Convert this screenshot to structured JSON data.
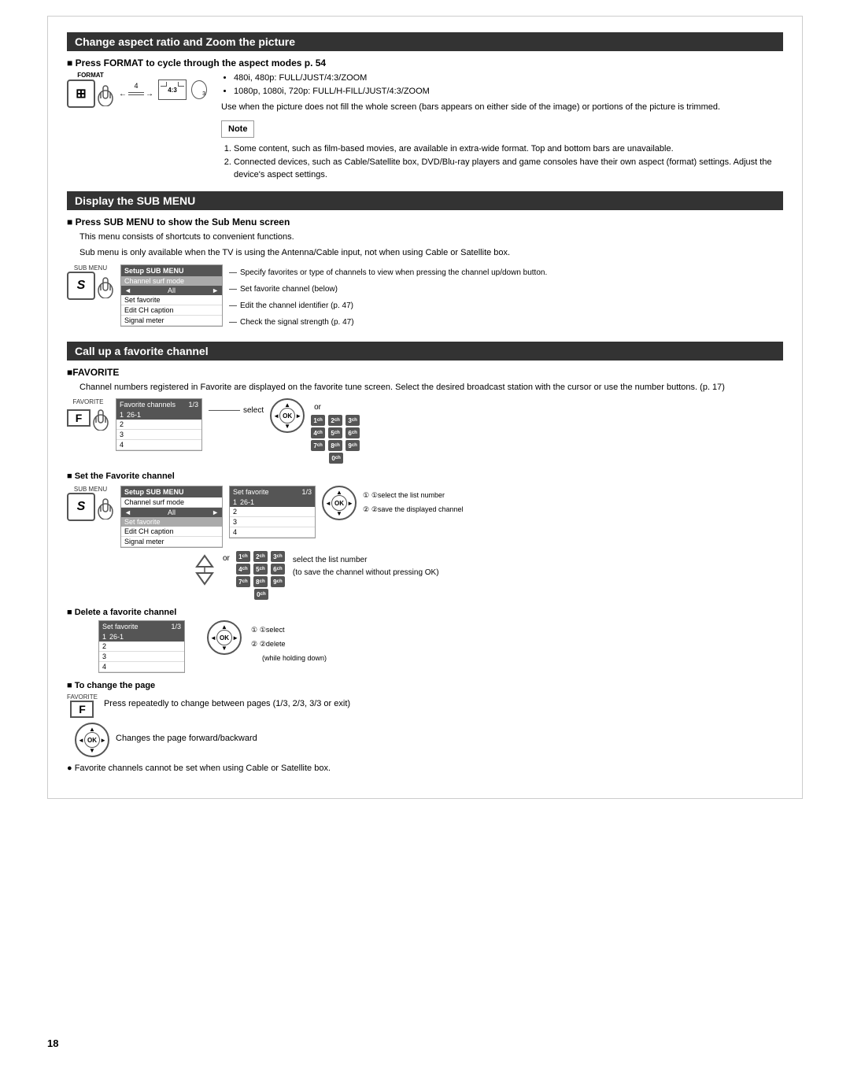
{
  "page": {
    "number": "18"
  },
  "section1": {
    "title": "Change aspect ratio and Zoom the picture",
    "subsection1": {
      "title": "■ Press FORMAT to cycle through the aspect modes p. 54",
      "format_label": "FORMAT",
      "arrow_label": "4",
      "ratio_label": "4:3",
      "bullets": [
        "480i, 480p: FULL/JUST/4:3/ZOOM",
        "1080p, 1080i, 720p: FULL/H-FILL/JUST/4:3/ZOOM"
      ],
      "use_text": "Use when the picture does not fill the whole screen (bars appears on either side of the image) or portions of the picture is trimmed.",
      "note_label": "Note",
      "note_items": [
        "Some content, such as film-based movies, are available in extra-wide format. Top and bottom bars are unavailable.",
        "Connected devices, such as Cable/Satellite box, DVD/Blu-ray players and game consoles have their own aspect (format) settings. Adjust the device's aspect settings."
      ]
    }
  },
  "section2": {
    "title": "Display the SUB MENU",
    "subsection1": {
      "title": "■ Press SUB MENU to show the Sub Menu screen",
      "desc1": "This menu consists of shortcuts to convenient functions.",
      "desc2": "Sub menu is only available when the TV is using the Antenna/Cable input, not when using Cable or Satellite box.",
      "sub_label": "SUB MENU",
      "menu_title": "Setup SUB MENU",
      "menu_items": [
        "Channel surf mode",
        "All",
        "Set favorite",
        "Edit CH caption",
        "Signal meter"
      ],
      "annotations": [
        "Specify favorites or type of channels to view when pressing the channel up/down button.",
        "Set favorite channel (below)",
        "Edit the channel identifier (p. 47)",
        "Check the signal strength (p. 47)"
      ]
    }
  },
  "section3": {
    "title": "Call up a favorite channel",
    "favorite_section": {
      "title": "■FAVORITE",
      "desc": "Channel numbers registered in Favorite are displayed on the favorite tune screen. Select the desired broadcast station with the cursor or use the number buttons. (p. 17)",
      "fav_label": "FAVORITE",
      "fav_channels_header": "Favorite channels",
      "fav_page": "1/3",
      "fav_rows": [
        {
          "num": "1",
          "val": "26-1"
        },
        {
          "num": "2",
          "val": ""
        },
        {
          "num": "3",
          "val": ""
        },
        {
          "num": "4",
          "val": ""
        }
      ],
      "select_label": "select",
      "or_label": "or"
    },
    "set_fav": {
      "title": "■ Set the Favorite channel",
      "sub_label": "SUB MENU",
      "menu_title": "Setup SUB MENU",
      "menu_items": [
        "Channel surf mode",
        "All",
        "Set favorite",
        "Edit CH caption",
        "Signal meter"
      ],
      "set_fav_header": "Set favorite",
      "set_fav_page": "1/3",
      "set_fav_rows": [
        {
          "num": "1",
          "val": "26-1"
        },
        {
          "num": "2",
          "val": ""
        },
        {
          "num": "3",
          "val": ""
        },
        {
          "num": "4",
          "val": ""
        }
      ],
      "step1": "①select the list number",
      "step2": "②save the displayed channel",
      "or_label": "or",
      "select_list_note": "select the list number",
      "save_note": "(to save the channel without pressing OK)"
    },
    "delete_fav": {
      "title": "■ Delete a favorite channel",
      "set_fav_header": "Set favorite",
      "set_fav_page": "1/3",
      "set_fav_rows": [
        {
          "num": "1",
          "val": "26-1"
        },
        {
          "num": "2",
          "val": ""
        },
        {
          "num": "3",
          "val": ""
        },
        {
          "num": "4",
          "val": ""
        }
      ],
      "step1": "①select",
      "step2": "②delete",
      "step2_note": "(while holding down)"
    },
    "change_page": {
      "title": "■ To change the page",
      "fav_label": "FAVORITE",
      "f_label": "F",
      "desc": "Press repeatedly to change between pages (1/3, 2/3, 3/3 or exit)",
      "ok_desc": "Changes the page forward/backward"
    },
    "bottom_note": "● Favorite channels cannot be set when using Cable or Satellite box."
  }
}
